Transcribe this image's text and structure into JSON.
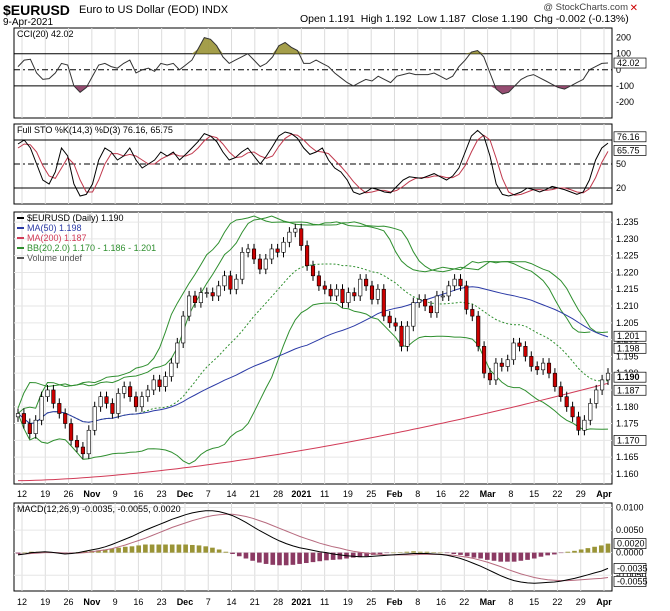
{
  "header": {
    "symbol": "$EURUSD",
    "description": "Euro to US Dollar (EOD)  INDX",
    "date": "9-Apr-2021",
    "open_label": "Open",
    "open": "1.191",
    "high_label": "High",
    "high": "1.192",
    "low_label": "Low",
    "low": "1.187",
    "close_label": "Close",
    "close": "1.190",
    "chg_label": "Chg",
    "chg": "-0.002 (-0.13%)",
    "credit": "@ StockCharts.com"
  },
  "colors": {
    "up": "#ffffff",
    "down": "#cc0000",
    "ma50": "#2b3aa6",
    "ma200": "#d13b57",
    "bb": "#2f8f2f",
    "cci_pos": "#9a9436",
    "cci_neg": "#8b3a63",
    "macd_pos": "#9a9436",
    "macd_neg": "#8b3a63"
  },
  "x_axis_labels": [
    "12",
    "19",
    "26",
    "Nov",
    "9",
    "16",
    "23",
    "Dec",
    "7",
    "14",
    "21",
    "28",
    "2021",
    "11",
    "19",
    "25",
    "Feb",
    "8",
    "16",
    "22",
    "Mar",
    "8",
    "15",
    "22",
    "29",
    "Apr"
  ],
  "chart_data": [
    {
      "type": "line",
      "title": "CCI(20) 42.02",
      "name": "CCI(20)",
      "ylim": [
        -300,
        260
      ],
      "yticks": [
        200,
        100,
        0,
        -100,
        -200
      ],
      "hlines": [
        100,
        0,
        -100
      ],
      "last_value_label": "42.02",
      "values": [
        20,
        60,
        65,
        -20,
        -60,
        -55,
        -20,
        40,
        30,
        -100,
        -140,
        -110,
        -40,
        30,
        40,
        20,
        10,
        40,
        60,
        -20,
        0,
        10,
        -10,
        40,
        30,
        40,
        0,
        30,
        60,
        130,
        200,
        190,
        150,
        80,
        40,
        60,
        80,
        100,
        60,
        20,
        40,
        80,
        150,
        170,
        140,
        120,
        40,
        40,
        60,
        40,
        20,
        -20,
        -50,
        -80,
        -100,
        -80,
        -60,
        -70,
        -40,
        -60,
        -80,
        -40,
        -30,
        -20,
        -30,
        -30,
        -30,
        -20,
        -40,
        -60,
        -40,
        20,
        60,
        110,
        120,
        80,
        -20,
        -120,
        -150,
        -140,
        -100,
        -60,
        -40,
        -30,
        -50,
        -70,
        -90,
        -110,
        -120,
        -100,
        -80,
        -60,
        0,
        20,
        40,
        42
      ]
    },
    {
      "type": "line",
      "title": "Full STO %K(14,3) %D(3) 76.16, 65.75",
      "ylim": [
        0,
        100
      ],
      "yticks": [
        50,
        20
      ],
      "hlines": [
        80,
        50,
        20
      ],
      "last_value_labels": [
        "76.16",
        "65.75"
      ],
      "series": [
        {
          "name": "%K(14,3)",
          "values": [
            75,
            80,
            70,
            50,
            30,
            25,
            40,
            70,
            60,
            25,
            10,
            12,
            25,
            55,
            70,
            65,
            55,
            60,
            70,
            55,
            45,
            50,
            55,
            65,
            60,
            65,
            55,
            62,
            70,
            78,
            88,
            85,
            78,
            65,
            55,
            58,
            65,
            70,
            60,
            50,
            60,
            72,
            85,
            90,
            88,
            82,
            70,
            62,
            65,
            70,
            55,
            45,
            40,
            30,
            15,
            12,
            15,
            20,
            18,
            15,
            14,
            22,
            30,
            34,
            33,
            32,
            35,
            38,
            34,
            30,
            35,
            45,
            65,
            85,
            92,
            85,
            60,
            25,
            12,
            10,
            12,
            15,
            20,
            18,
            15,
            18,
            22,
            20,
            18,
            15,
            12,
            15,
            30,
            55,
            70,
            76.16
          ]
        },
        {
          "name": "%D(3)",
          "values": [
            70,
            75,
            74,
            65,
            48,
            35,
            32,
            45,
            58,
            50,
            30,
            15,
            15,
            30,
            50,
            63,
            63,
            60,
            62,
            60,
            55,
            50,
            50,
            56,
            60,
            63,
            60,
            60,
            63,
            70,
            79,
            85,
            83,
            75,
            65,
            58,
            59,
            64,
            65,
            60,
            57,
            60,
            72,
            82,
            87,
            86,
            80,
            72,
            66,
            65,
            63,
            55,
            47,
            38,
            28,
            20,
            14,
            15,
            17,
            17,
            15,
            17,
            22,
            28,
            32,
            33,
            33,
            35,
            35,
            33,
            33,
            37,
            48,
            65,
            80,
            86,
            80,
            57,
            32,
            15,
            11,
            12,
            15,
            18,
            18,
            17,
            18,
            20,
            20,
            18,
            15,
            14,
            19,
            33,
            52,
            65.75
          ]
        }
      ]
    },
    {
      "type": "candlestick",
      "title": "$EURUSD (Daily) 1.190",
      "ylim": [
        1.157,
        1.238
      ],
      "yticks": [
        1.235,
        1.23,
        1.225,
        1.22,
        1.215,
        1.21,
        1.205,
        1.2,
        1.195,
        1.19,
        1.185,
        1.18,
        1.175,
        1.17,
        1.165,
        1.16
      ],
      "legend": [
        "$EURUSD (Daily) 1.190",
        "MA(50) 1.198",
        "MA(200) 1.187",
        "BB(20,2.0) 1.170 - 1.186 - 1.201",
        "Volume undef"
      ],
      "last_value_labels": [
        "1.201",
        "1.198",
        "1.190",
        "1.187",
        "1.170"
      ],
      "close": [
        1.178,
        1.175,
        1.172,
        1.176,
        1.183,
        1.185,
        1.181,
        1.178,
        1.175,
        1.17,
        1.168,
        1.166,
        1.173,
        1.18,
        1.183,
        1.181,
        1.178,
        1.184,
        1.186,
        1.183,
        1.18,
        1.183,
        1.185,
        1.188,
        1.186,
        1.189,
        1.193,
        1.199,
        1.207,
        1.213,
        1.211,
        1.214,
        1.214,
        1.213,
        1.216,
        1.219,
        1.215,
        1.218,
        1.226,
        1.227,
        1.224,
        1.221,
        1.224,
        1.227,
        1.226,
        1.229,
        1.232,
        1.233,
        1.228,
        1.222,
        1.219,
        1.216,
        1.215,
        1.213,
        1.215,
        1.211,
        1.214,
        1.213,
        1.218,
        1.216,
        1.212,
        1.215,
        1.207,
        1.205,
        1.204,
        1.198,
        1.204,
        1.211,
        1.212,
        1.21,
        1.208,
        1.213,
        1.213,
        1.216,
        1.218,
        1.216,
        1.209,
        1.207,
        1.198,
        1.19,
        1.188,
        1.193,
        1.192,
        1.194,
        1.199,
        1.198,
        1.195,
        1.192,
        1.191,
        1.193,
        1.19,
        1.186,
        1.183,
        1.18,
        1.177,
        1.173,
        1.176,
        1.181,
        1.185,
        1.188,
        1.19
      ]
    },
    {
      "type": "line",
      "title": "MACD(12,26,9) -0.0035, -0.0055, 0.0020",
      "ylim": [
        -0.0085,
        0.011
      ],
      "yticks": [
        0.01,
        0.005,
        0.0,
        -0.005
      ],
      "last_value_labels": [
        "0.0020",
        "-0.0035",
        "-0.0055"
      ],
      "series": [
        {
          "name": "MACD",
          "values": [
            -0.0005,
            -0.0003,
            0,
            0.0001,
            0.0002,
            0.0001,
            -0.0001,
            -0.0003,
            -0.0002,
            0,
            0.0003,
            0.0006,
            0.0009,
            0.0013,
            0.0018,
            0.0024,
            0.003,
            0.0036,
            0.0043,
            0.005,
            0.0056,
            0.0062,
            0.0068,
            0.0074,
            0.0079,
            0.0084,
            0.0088,
            0.0091,
            0.0093,
            0.0093,
            0.0091,
            0.0087,
            0.0082,
            0.0075,
            0.0067,
            0.0058,
            0.0049,
            0.0041,
            0.0033,
            0.0026,
            0.002,
            0.0015,
            0.0011,
            0.0008,
            0.0005,
            0.0002,
            0,
            -0.0003,
            -0.0005,
            -0.0007,
            -0.0008,
            -0.0009,
            -0.0009,
            -0.0008,
            -0.0007,
            -0.0006,
            -0.0005,
            -0.0004,
            -0.0003,
            -0.0002,
            -0.0002,
            -0.0002,
            -0.0003,
            -0.0004,
            -0.0006,
            -0.0009,
            -0.0013,
            -0.0018,
            -0.0024,
            -0.003,
            -0.0037,
            -0.0044,
            -0.0051,
            -0.0057,
            -0.0062,
            -0.0065,
            -0.0067,
            -0.0068,
            -0.0067,
            -0.0066,
            -0.0065,
            -0.0063,
            -0.006,
            -0.0057,
            -0.0053,
            -0.0049,
            -0.0045,
            -0.0041,
            -0.0035
          ]
        },
        {
          "name": "Signal",
          "values": [
            -0.0003,
            -0.0003,
            -0.0002,
            -0.0001,
            0,
            0,
            0,
            -0.0001,
            -0.0001,
            -0.0001,
            0,
            0.0002,
            0.0004,
            0.0006,
            0.0009,
            0.0013,
            0.0017,
            0.0022,
            0.0027,
            0.0032,
            0.0038,
            0.0044,
            0.005,
            0.0056,
            0.0061,
            0.0066,
            0.0071,
            0.0075,
            0.0079,
            0.0082,
            0.0084,
            0.0085,
            0.0085,
            0.0083,
            0.008,
            0.0076,
            0.0071,
            0.0066,
            0.006,
            0.0054,
            0.0048,
            0.0042,
            0.0036,
            0.0031,
            0.0026,
            0.0021,
            0.0017,
            0.0013,
            0.001,
            0.0006,
            0.0003,
            0.0001,
            -0.0001,
            -0.0003,
            -0.0004,
            -0.0005,
            -0.0005,
            -0.0005,
            -0.0005,
            -0.0005,
            -0.0004,
            -0.0004,
            -0.0004,
            -0.0004,
            -0.0005,
            -0.0006,
            -0.0008,
            -0.001,
            -0.0013,
            -0.0017,
            -0.0021,
            -0.0026,
            -0.0031,
            -0.0037,
            -0.0042,
            -0.0047,
            -0.0051,
            -0.0055,
            -0.0058,
            -0.006,
            -0.0061,
            -0.0062,
            -0.0062,
            -0.0061,
            -0.006,
            -0.0059,
            -0.0058,
            -0.0057,
            -0.0055
          ]
        }
      ]
    }
  ]
}
